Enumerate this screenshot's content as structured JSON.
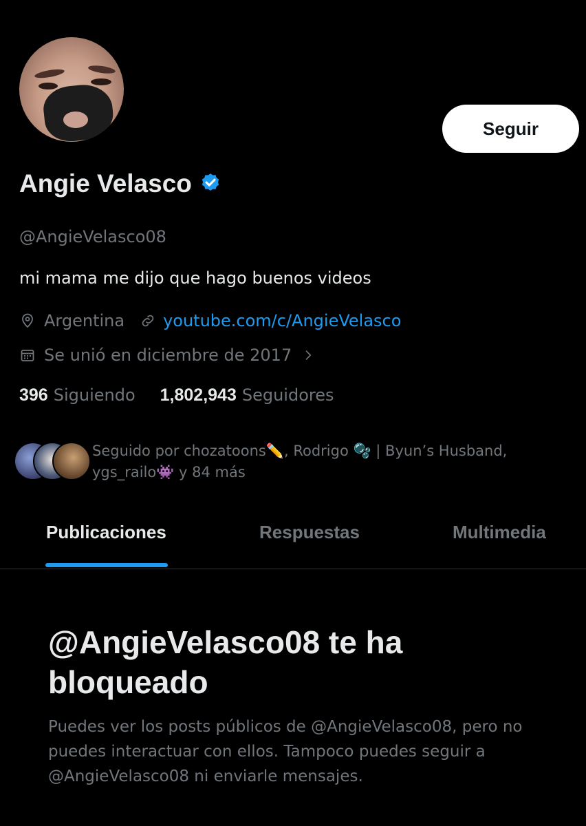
{
  "profile": {
    "display_name": "Angie Velasco",
    "handle": "@AngieVelasco08",
    "bio": "mi mama me dijo que hago buenos videos",
    "location": "Argentina",
    "website": "youtube.com/c/AngieVelasco",
    "joined": "Se unió en diciembre de 2017",
    "verified": true,
    "verified_color": "#1d9bf0"
  },
  "actions": {
    "follow_label": "Seguir"
  },
  "stats": {
    "following_count": "396",
    "following_label": "Siguiendo",
    "followers_count": "1,802,943",
    "followers_label": "Seguidores"
  },
  "followed_by": {
    "line1": "Seguido por chozatoons✏️, Rodrigo 🫧 | Byun’s Husband,",
    "line2": "ygs_railo👾 y 84 más"
  },
  "tabs": [
    {
      "label": "Publicaciones",
      "active": true
    },
    {
      "label": "Respuestas",
      "active": false
    },
    {
      "label": "Multimedia",
      "active": false
    }
  ],
  "blocked": {
    "title": "@AngieVelasco08 te ha bloqueado",
    "description": "Puedes ver los posts públicos de @AngieVelasco08, pero no puedes interactuar con ellos. Tampoco puedes seguir a @AngieVelasco08 ni enviarle mensajes."
  },
  "colors": {
    "background": "#000000",
    "primary_text": "#e7e9ea",
    "secondary_text": "#71767b",
    "accent": "#1d9bf0"
  }
}
